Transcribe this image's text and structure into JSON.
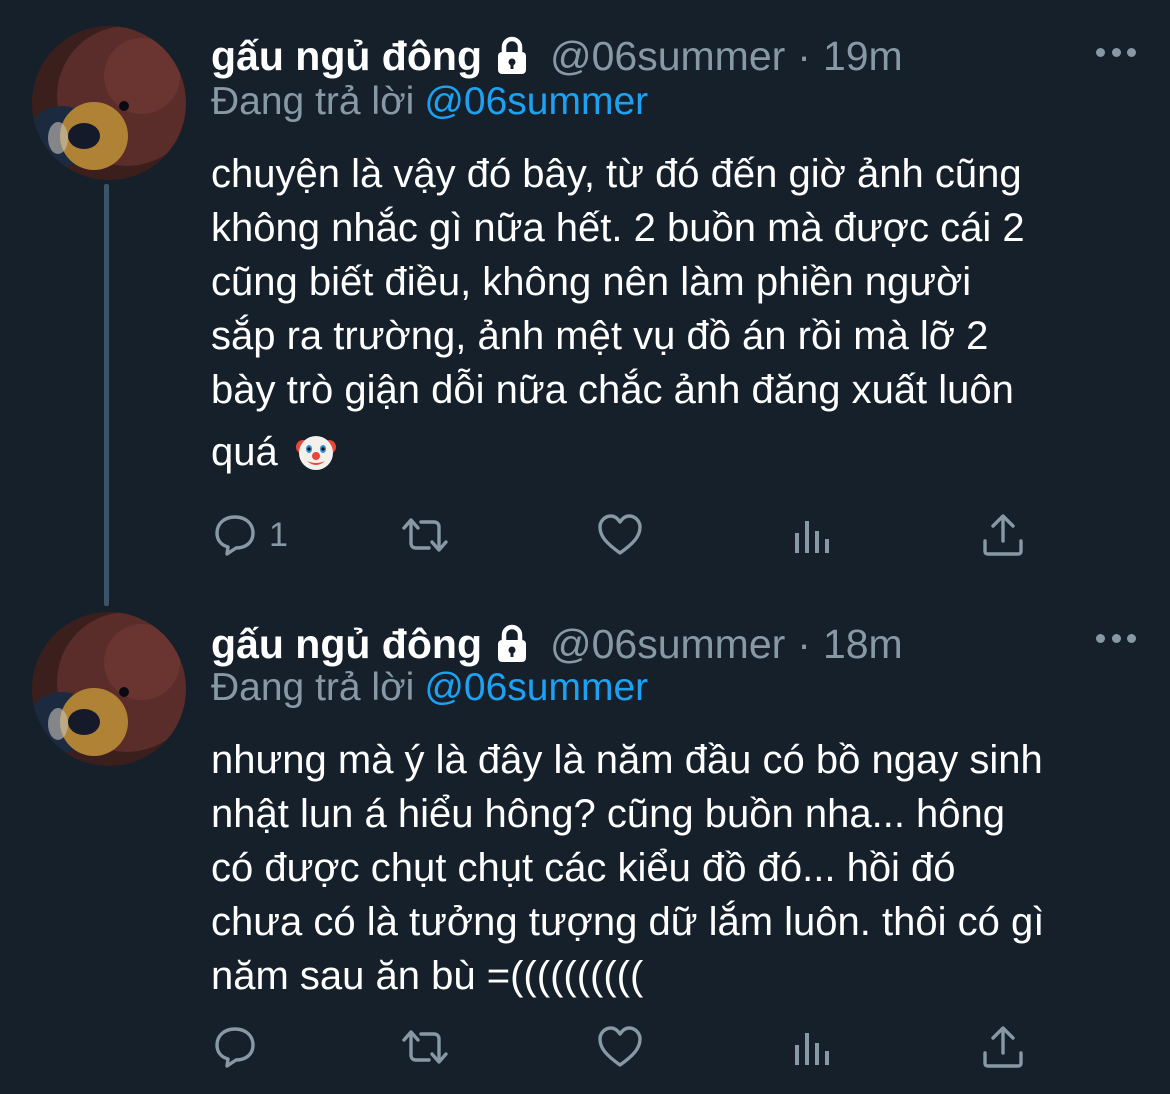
{
  "colors": {
    "background": "#15202b",
    "text": "#ffffff",
    "muted": "#8899a6",
    "link": "#1da1f2",
    "thread_line": "#3d5466"
  },
  "tweets": [
    {
      "author": "gấu ngủ đông",
      "handle": "@06summer",
      "separator": "·",
      "time": "19m",
      "replying_prefix": "Đang trả lời",
      "replying_to": "@06summer",
      "body_lines": [
        "chuyện là vậy đó bây, từ đó đến giờ ảnh cũng",
        "không nhắc gì nữa hết. 2 buồn mà được cái 2",
        "cũng biết điều, không nên làm phiền người",
        "sắp ra trường, ảnh mệt vụ đồ án rồi mà lỡ 2",
        "bày trò giận dỗi nữa chắc ảnh đăng xuất luôn"
      ],
      "body_last": "quá",
      "emoji": "clown-face-emoji",
      "reply_count": "1",
      "icons": [
        "reply-icon",
        "retweet-icon",
        "like-icon",
        "analytics-icon",
        "share-icon"
      ]
    },
    {
      "author": "gấu ngủ đông",
      "handle": "@06summer",
      "separator": "·",
      "time": "18m",
      "replying_prefix": "Đang trả lời",
      "replying_to": "@06summer",
      "body_lines": [
        "nhưng mà ý là đây là năm đầu có bồ ngay sinh",
        "nhật lun á hiểu hông? cũng buồn nha... hông",
        "có được chụt chụt các kiểu đồ đó... hồi đó",
        "chưa có là tưởng tượng dữ lắm luôn. thôi có gì",
        "năm sau ăn bù =(((((((((("
      ],
      "reply_count": "",
      "icons": [
        "reply-icon",
        "retweet-icon",
        "like-icon",
        "analytics-icon",
        "share-icon"
      ]
    }
  ]
}
